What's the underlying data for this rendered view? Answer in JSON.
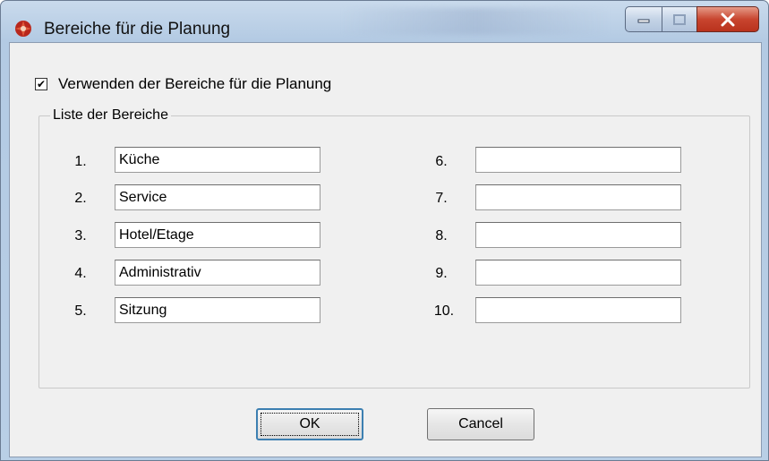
{
  "window": {
    "title": "Bereiche für die Planung",
    "controls": {
      "minimize_icon": "minimize-icon",
      "maximize_icon": "maximize-icon",
      "close_icon": "close-icon"
    }
  },
  "options": {
    "use_areas": {
      "label": "Verwenden der Bereiche für die Planung",
      "checked": true,
      "check_glyph": "✔"
    }
  },
  "group": {
    "legend": "Liste der Bereiche",
    "items": [
      {
        "number": "1.",
        "value": "Küche"
      },
      {
        "number": "2.",
        "value": "Service"
      },
      {
        "number": "3.",
        "value": "Hotel/Etage"
      },
      {
        "number": "4.",
        "value": "Administrativ"
      },
      {
        "number": "5.",
        "value": "Sitzung"
      },
      {
        "number": "6.",
        "value": ""
      },
      {
        "number": "7.",
        "value": ""
      },
      {
        "number": "8.",
        "value": ""
      },
      {
        "number": "9.",
        "value": ""
      },
      {
        "number": "10.",
        "value": ""
      }
    ]
  },
  "buttons": {
    "ok": "OK",
    "cancel": "Cancel"
  },
  "colors": {
    "close_button": "#c8452f",
    "focus_border": "#3c7fb1",
    "title_bar": "#b9cfe6"
  }
}
